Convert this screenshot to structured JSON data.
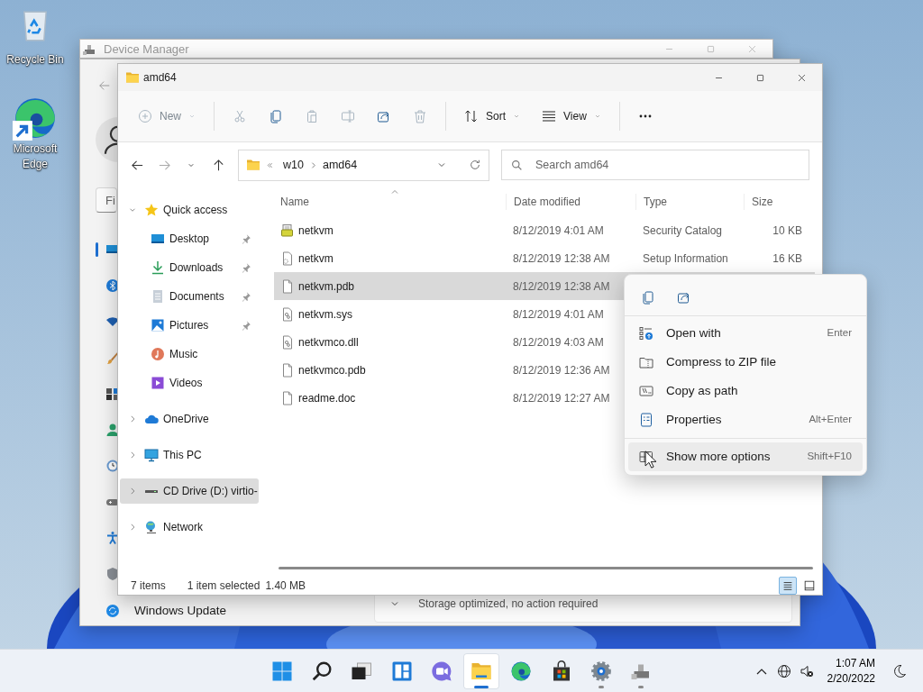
{
  "desktop_icons": [
    {
      "label": "Recycle Bin",
      "kind": "recycle"
    },
    {
      "label": "Microsoft Edge",
      "kind": "browser"
    }
  ],
  "device_manager": {
    "title": "Device Manager"
  },
  "settings": {
    "search": {
      "placeholder": "Fi"
    },
    "nav_icons": [
      {
        "kind": "system",
        "selected": true
      },
      {
        "kind": "bluetooth",
        "selected": false
      },
      {
        "kind": "wifi",
        "selected": false
      },
      {
        "kind": "personalize",
        "selected": false
      },
      {
        "kind": "apps",
        "selected": false
      },
      {
        "kind": "accounts",
        "selected": false
      },
      {
        "kind": "time",
        "selected": false
      },
      {
        "kind": "gaming",
        "selected": false
      },
      {
        "kind": "accessibility",
        "selected": false
      },
      {
        "kind": "privacy",
        "selected": false
      }
    ],
    "bottom_item": "Windows Update",
    "storage_status": "Storage optimized, no action required"
  },
  "explorer": {
    "title": "amd64",
    "toolbar": [
      {
        "kind": "new",
        "label": "New",
        "disabled": true,
        "dropdown": true,
        "group_end": true
      },
      {
        "kind": "cut",
        "disabled": true
      },
      {
        "kind": "copy",
        "disabled": false
      },
      {
        "kind": "paste",
        "disabled": true
      },
      {
        "kind": "rename",
        "disabled": true
      },
      {
        "kind": "share",
        "disabled": false
      },
      {
        "kind": "delete",
        "disabled": true,
        "group_end": true
      },
      {
        "kind": "sort",
        "label": "Sort",
        "disabled": false,
        "dropdown": true
      },
      {
        "kind": "view",
        "label": "View",
        "disabled": false,
        "dropdown": true,
        "group_end": true
      },
      {
        "kind": "more",
        "disabled": false
      }
    ],
    "nav_buttons": [
      {
        "kind": "back",
        "disabled": false
      },
      {
        "kind": "forward",
        "disabled": true
      },
      {
        "kind": "recent",
        "disabled": false
      },
      {
        "kind": "up",
        "disabled": false
      }
    ],
    "breadcrumb": [
      "w10",
      "amd64"
    ],
    "search": {
      "placeholder": "Search amd64"
    },
    "nav_pane": [
      {
        "label": "Quick access",
        "kind": "star",
        "expanded": true,
        "selected": false,
        "children": [
          {
            "label": "Desktop",
            "kind": "desktop",
            "pinned": true,
            "selected": false
          },
          {
            "label": "Downloads",
            "kind": "download",
            "pinned": true,
            "selected": false
          },
          {
            "label": "Documents",
            "kind": "documents",
            "pinned": true,
            "selected": false
          },
          {
            "label": "Pictures",
            "kind": "pictures",
            "pinned": true,
            "selected": false
          },
          {
            "label": "Music",
            "kind": "music",
            "pinned": false,
            "selected": false
          },
          {
            "label": "Videos",
            "kind": "videos",
            "pinned": false,
            "selected": false
          }
        ]
      },
      {
        "label": "OneDrive",
        "kind": "cloud",
        "expanded": false,
        "selected": false
      },
      {
        "label": "This PC",
        "kind": "pc",
        "expanded": false,
        "selected": false
      },
      {
        "label": "CD Drive (D:) virtio-",
        "kind": "drive",
        "expanded": false,
        "selected": true
      },
      {
        "label": "Network",
        "kind": "network",
        "expanded": false,
        "selected": false
      }
    ],
    "columns": [
      {
        "label": "Name",
        "sorted": true
      },
      {
        "label": "Date modified",
        "sorted": false
      },
      {
        "label": "Type",
        "sorted": false
      },
      {
        "label": "Size",
        "sorted": false
      }
    ],
    "files": [
      {
        "name": "netkvm",
        "kind": "catalog",
        "date": "8/12/2019 4:01 AM",
        "type": "Security Catalog",
        "size": "10 KB",
        "selected": false
      },
      {
        "name": "netkvm",
        "kind": "setup",
        "date": "8/12/2019 12:38 AM",
        "type": "Setup Information",
        "size": "16 KB",
        "selected": false
      },
      {
        "name": "netkvm.pdb",
        "kind": "blank",
        "date": "8/12/2019 12:38 AM",
        "selected": true
      },
      {
        "name": "netkvm.sys",
        "kind": "system",
        "date": "8/12/2019 4:01 AM",
        "selected": false
      },
      {
        "name": "netkvmco.dll",
        "kind": "system",
        "date": "8/12/2019 4:03 AM",
        "selected": false
      },
      {
        "name": "netkvmco.pdb",
        "kind": "blank",
        "date": "8/12/2019 12:36 AM",
        "selected": false
      },
      {
        "name": "readme.doc",
        "kind": "blank",
        "date": "8/12/2019 12:27 AM",
        "selected": false
      }
    ],
    "status": {
      "count": "7 items",
      "selection": "1 item selected",
      "size": "1.40 MB"
    },
    "layouts": [
      {
        "kind": "details",
        "selected": true
      },
      {
        "kind": "tiles",
        "selected": false
      }
    ]
  },
  "context_menu": {
    "quick_actions": [
      {
        "kind": "copy"
      },
      {
        "kind": "share"
      }
    ],
    "items": [
      {
        "label": "Open with",
        "kind": "openwith",
        "shortcut": "Enter",
        "hovered": false
      },
      {
        "label": "Compress to ZIP file",
        "kind": "zip",
        "hovered": false
      },
      {
        "label": "Copy as path",
        "kind": "path",
        "hovered": false
      },
      {
        "label": "Properties",
        "kind": "properties",
        "shortcut": "Alt+Enter",
        "hovered": false
      },
      {
        "label": "Show more options",
        "kind": "showmore",
        "shortcut": "Shift+F10",
        "hovered": true,
        "divider_before": true
      }
    ]
  },
  "taskbar": {
    "apps": [
      {
        "kind": "start",
        "running": false,
        "active": false
      },
      {
        "kind": "search",
        "running": false,
        "active": false
      },
      {
        "kind": "taskview",
        "running": false,
        "active": false
      },
      {
        "kind": "widgets",
        "running": false,
        "active": false
      },
      {
        "kind": "chat",
        "running": false,
        "active": false
      },
      {
        "kind": "explorer",
        "running": true,
        "active": true
      },
      {
        "kind": "browser",
        "running": false,
        "active": false
      },
      {
        "kind": "store",
        "running": false,
        "active": false
      },
      {
        "kind": "settings",
        "running": true,
        "active": false
      },
      {
        "kind": "devices",
        "running": true,
        "active": false
      }
    ],
    "tray": [
      {
        "kind": "overflow"
      },
      {
        "kind": "network"
      },
      {
        "kind": "volume_muted"
      }
    ],
    "time": "1:07 AM",
    "date": "2/20/2022"
  }
}
